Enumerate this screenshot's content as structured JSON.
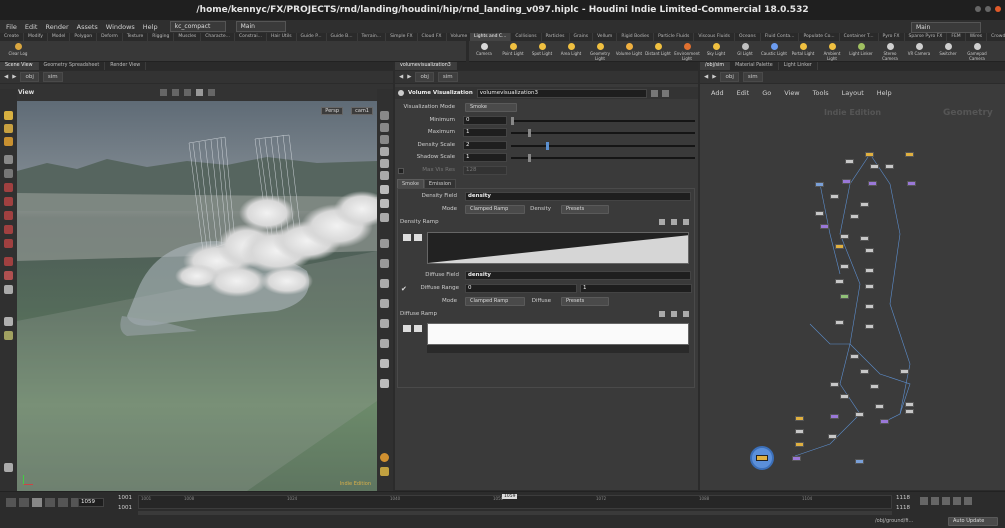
{
  "window": {
    "title": "/home/kennyc/FX/PROJECTS/rnd/landing/houdini/hip/rnd_landing_v097.hiplc - Houdini Indie Limited-Commercial 18.0.532"
  },
  "menubar": {
    "items": [
      "File",
      "Edit",
      "Render",
      "Assets",
      "Windows",
      "Help"
    ],
    "desktop_left": "kc_compact",
    "desktop_mid": "Main",
    "desktop_right": "Main"
  },
  "shelf_tabs_left": [
    "Create",
    "Modify",
    "Model",
    "Polygon",
    "Deform",
    "Texture",
    "Rigging",
    "Muscles",
    "Characte...",
    "Constrai...",
    "Hair Utils",
    "Guide P...",
    "Guide B...",
    "Terrain...",
    "Simple FX",
    "Cloud FX",
    "Volume",
    "RC Tools"
  ],
  "shelf_tabs_right": [
    "Lights and C...",
    "Collisions",
    "Particles",
    "Grains",
    "Vellum",
    "Rigid Bodies",
    "Particle Fluids",
    "Viscous Fluids",
    "Oceans",
    "Fluid Conta...",
    "Populate Co...",
    "Container T...",
    "Pyro FX",
    "Sparse Pyro FX",
    "FEM",
    "Wires",
    "Crowds",
    "Drive Simul..."
  ],
  "shelf_tools_left": [
    "Clear Log"
  ],
  "shelf_tools_right": [
    "Camera",
    "Point Light",
    "Spot Light",
    "Area Light",
    "Geometry Light",
    "Volume Light",
    "Distant Light",
    "Environment Light",
    "Sky Light",
    "GI Light",
    "Caustic Light",
    "Portal Light",
    "Ambient Light",
    "Light Linker",
    "Stereo Camera",
    "VR Camera",
    "Switcher",
    "Gamepad Camera"
  ],
  "left_pane": {
    "tabs": [
      "Scene View",
      "Geometry Spreadsheet",
      "Render View"
    ],
    "path": [
      "obj",
      "sim"
    ],
    "view_label": "View",
    "persp": "Persp",
    "cam": "cam1",
    "watermark": "Indie Edition"
  },
  "mid_pane": {
    "tabs": [
      "volumevisualization3"
    ],
    "path": [
      "obj",
      "sim"
    ],
    "node_type": "Volume Visualization",
    "node_name": "volumevisualization3",
    "params": {
      "vis_mode_label": "Visualization Mode",
      "vis_mode": "Smoke",
      "minimum_label": "Minimum",
      "minimum": "0",
      "maximum_label": "Maximum",
      "maximum": "1",
      "density_scale_label": "Density Scale",
      "density_scale": "2",
      "shadow_scale_label": "Shadow Scale",
      "shadow_scale": "1",
      "max_vis_res_label": "Max Vis Res",
      "max_vis_res": "128"
    },
    "subtabs": [
      "Smoke",
      "Emission"
    ],
    "smoke": {
      "density_field_label": "Density Field",
      "density_field": "density",
      "mode_label": "Mode",
      "mode": "Clamped Ramp",
      "density_label": "Density",
      "density_preset": "Presets",
      "density_ramp_label": "Density Ramp",
      "diffuse_field_label": "Diffuse Field",
      "diffuse_field": "density",
      "diffuse_range_label": "Diffuse Range",
      "diffuse_range_min": "0",
      "diffuse_range_max": "1",
      "mode2_label": "Mode",
      "mode2": "Clamped Ramp",
      "diffuse_label": "Diffuse",
      "diffuse_preset": "Presets",
      "diffuse_ramp_label": "Diffuse Ramp"
    }
  },
  "right_pane": {
    "tabs": [
      "/obj/sim",
      "Material Palette",
      "Light Linker"
    ],
    "path": [
      "obj",
      "sim"
    ],
    "menu": [
      "Add",
      "Edit",
      "Go",
      "View",
      "Tools",
      "Layout",
      "Help"
    ],
    "watermark": "Indie Edition",
    "context": "Geometry"
  },
  "timeline": {
    "current_frame": "1059",
    "start": "1001",
    "start2": "1001",
    "end": "1118",
    "end2": "1118",
    "ticks": [
      "1001",
      "1008",
      "1024",
      "1040",
      "1056",
      "1072",
      "1088",
      "1104"
    ],
    "playhead_label": "1059",
    "path": "/obj/ground/fi...",
    "auto_update": "Auto Update"
  },
  "colors": {
    "accent": "#e0b040",
    "node_blue": "#7aa0d8",
    "node_purple": "#9a78d8",
    "bg": "#2b2b2b"
  }
}
